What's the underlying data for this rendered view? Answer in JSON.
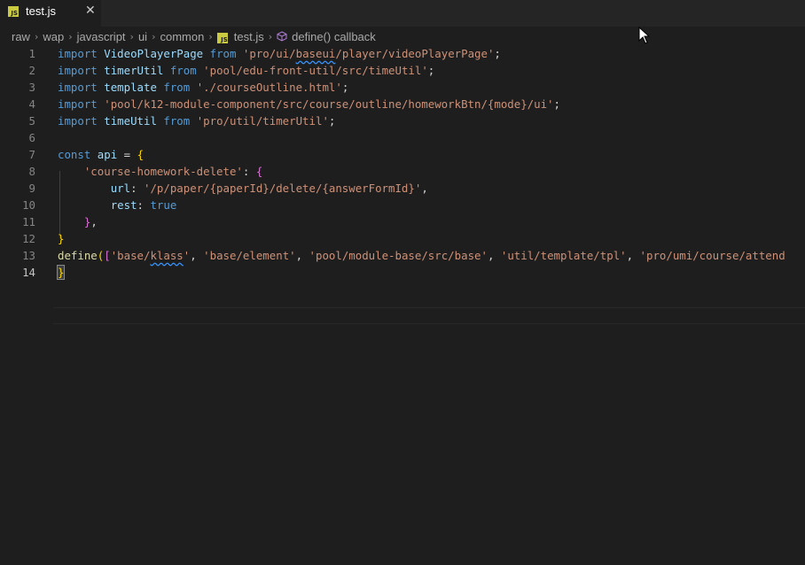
{
  "tab": {
    "title": "test.js",
    "close_glyph": "✕",
    "icon": "js-file-icon",
    "badge": "JS"
  },
  "breadcrumb": {
    "items": [
      "raw",
      "wap",
      "javascript",
      "ui",
      "common"
    ],
    "file": "test.js",
    "symbol": "define() callback",
    "separator": "›"
  },
  "editor": {
    "active_line": 14,
    "line_numbers": [
      "1",
      "2",
      "3",
      "4",
      "5",
      "6",
      "7",
      "8",
      "9",
      "10",
      "11",
      "12",
      "13",
      "14"
    ],
    "lines": [
      [
        [
          "k",
          "import"
        ],
        [
          "p",
          " "
        ],
        [
          "c",
          "VideoPlayerPage"
        ],
        [
          "p",
          " "
        ],
        [
          "k",
          "from"
        ],
        [
          "p",
          " "
        ],
        [
          "s",
          "'pro/ui/"
        ],
        [
          "sq",
          "baseui"
        ],
        [
          "s",
          "/player/videoPlayerPage'"
        ],
        [
          "p",
          ";"
        ]
      ],
      [
        [
          "k",
          "import"
        ],
        [
          "p",
          " "
        ],
        [
          "c",
          "timerUtil"
        ],
        [
          "p",
          " "
        ],
        [
          "k",
          "from"
        ],
        [
          "p",
          " "
        ],
        [
          "s",
          "'pool/edu-front-util/src/timeUtil'"
        ],
        [
          "p",
          ";"
        ]
      ],
      [
        [
          "k",
          "import"
        ],
        [
          "p",
          " "
        ],
        [
          "c",
          "template"
        ],
        [
          "p",
          " "
        ],
        [
          "k",
          "from"
        ],
        [
          "p",
          " "
        ],
        [
          "s",
          "'./courseOutline.html'"
        ],
        [
          "p",
          ";"
        ]
      ],
      [
        [
          "k",
          "import"
        ],
        [
          "p",
          " "
        ],
        [
          "s",
          "'pool/k12-module-component/src/course/outline/homeworkBtn/{mode}/ui'"
        ],
        [
          "p",
          ";"
        ]
      ],
      [
        [
          "k",
          "import"
        ],
        [
          "p",
          " "
        ],
        [
          "c",
          "timeUtil"
        ],
        [
          "p",
          " "
        ],
        [
          "k",
          "from"
        ],
        [
          "p",
          " "
        ],
        [
          "s",
          "'pro/util/timerUtil'"
        ],
        [
          "p",
          ";"
        ]
      ],
      [],
      [
        [
          "k",
          "const"
        ],
        [
          "p",
          " "
        ],
        [
          "c",
          "api"
        ],
        [
          "p",
          " = "
        ],
        [
          "b1",
          "{"
        ]
      ],
      [
        [
          "p",
          "    "
        ],
        [
          "s",
          "'course-homework-delete'"
        ],
        [
          "p",
          ": "
        ],
        [
          "b2",
          "{"
        ]
      ],
      [
        [
          "p",
          "        "
        ],
        [
          "c",
          "url"
        ],
        [
          "p",
          ": "
        ],
        [
          "s",
          "'/p/paper/{paperId}/delete/{answerFormId}'"
        ],
        [
          "p",
          ","
        ]
      ],
      [
        [
          "p",
          "        "
        ],
        [
          "c",
          "rest"
        ],
        [
          "p",
          ": "
        ],
        [
          "k",
          "true"
        ]
      ],
      [
        [
          "p",
          "    "
        ],
        [
          "b2",
          "}"
        ],
        [
          "p",
          ","
        ]
      ],
      [
        [
          "b1",
          "}"
        ]
      ],
      [
        [
          "f",
          "define"
        ],
        [
          "b1",
          "("
        ],
        [
          "b2",
          "["
        ],
        [
          "s",
          "'base/"
        ],
        [
          "sq",
          "klass"
        ],
        [
          "s",
          "'"
        ],
        [
          "p",
          ", "
        ],
        [
          "s",
          "'base/element'"
        ],
        [
          "p",
          ", "
        ],
        [
          "s",
          "'pool/module-base/src/base'"
        ],
        [
          "p",
          ", "
        ],
        [
          "s",
          "'util/template/tpl'"
        ],
        [
          "p",
          ", "
        ],
        [
          "s",
          "'pro/umi/course/attend"
        ]
      ],
      [
        [
          "cursor",
          "}"
        ]
      ]
    ]
  },
  "colors": {
    "background": "#1e1e1e",
    "keyword": "#569cd6",
    "string": "#ce9178",
    "variable": "#9cdcfe",
    "function": "#dcdcaa"
  }
}
